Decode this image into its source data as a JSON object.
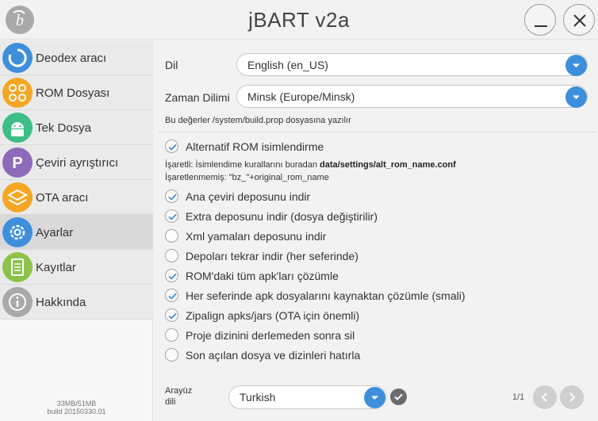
{
  "window": {
    "title": "jBART v2a",
    "logo_icon": "jbart-logo-icon",
    "minimize_icon": "minimize-icon",
    "close_icon": "close-icon"
  },
  "sidebar": {
    "items": [
      {
        "label": "Deodex aracı",
        "icon": "refresh-circle-icon",
        "color": "#3d8fdc"
      },
      {
        "label": "ROM Dosyası",
        "icon": "rom-grid-icon",
        "color": "#f5a623"
      },
      {
        "label": "Tek Dosya",
        "icon": "android-icon",
        "color": "#3cbf85"
      },
      {
        "label": "Çeviri ayrıştırıcı",
        "icon": "letter-p-icon",
        "color": "#8e6bb8"
      },
      {
        "label": "OTA aracı",
        "icon": "layers-icon",
        "color": "#f5a623"
      },
      {
        "label": "Ayarlar",
        "icon": "gear-icon",
        "color": "#3d8fdc",
        "active": true
      },
      {
        "label": "Kayıtlar",
        "icon": "log-file-icon",
        "color": "#8cc34a"
      },
      {
        "label": "Hakkında",
        "icon": "info-icon",
        "color": "#a9a9a9"
      }
    ],
    "memory": "33MB/51MB",
    "build": "build 20150330.01"
  },
  "settings": {
    "language": {
      "label": "Dil",
      "value": "English (en_US)"
    },
    "timezone": {
      "label": "Zaman Dilimi",
      "value": "Minsk (Europe/Minsk)"
    },
    "build_prop_note": "Bu değerler /system/build.prop dosyasına yazılır",
    "alt_rom": {
      "label": "Alternatif ROM isimlendirme",
      "checked": true,
      "note_checked_prefix": "İşaretli: İsimlendime kurallarını buradan ",
      "note_checked_path": "data/settings/alt_rom_name.conf",
      "note_unchecked": "İşaretlenmemiş: \"bz_\"+original_rom_name"
    },
    "options": [
      {
        "label": "Ana çeviri deposunu indir",
        "checked": true
      },
      {
        "label": "Extra deposunu indir (dosya değiştirilir)",
        "checked": true
      },
      {
        "label": "Xml yamaları deposunu indir",
        "checked": false
      },
      {
        "label": "Depoları tekrar indir (her seferinde)",
        "checked": false
      },
      {
        "label": "ROM'daki tüm apk'ları çözümle",
        "checked": true
      },
      {
        "label": "Her seferinde apk dosyalarını kaynaktan çözümle (smali)",
        "checked": true
      },
      {
        "label": "Zipalign apks/jars (OTA için önemli)",
        "checked": true
      },
      {
        "label": "Proje dizinini derlemeden sonra sil",
        "checked": false
      },
      {
        "label": "Son açılan dosya ve dizinleri hatırla",
        "checked": false
      }
    ],
    "ui_language": {
      "label_line1": "Arayüz",
      "label_line2": "dili",
      "value": "Turkish"
    }
  },
  "pagination": {
    "indicator": "1/1",
    "prev_label": "<",
    "next_label": ">"
  },
  "colors": {
    "accent": "#3d8fdc",
    "check": "#3d8fdc"
  }
}
